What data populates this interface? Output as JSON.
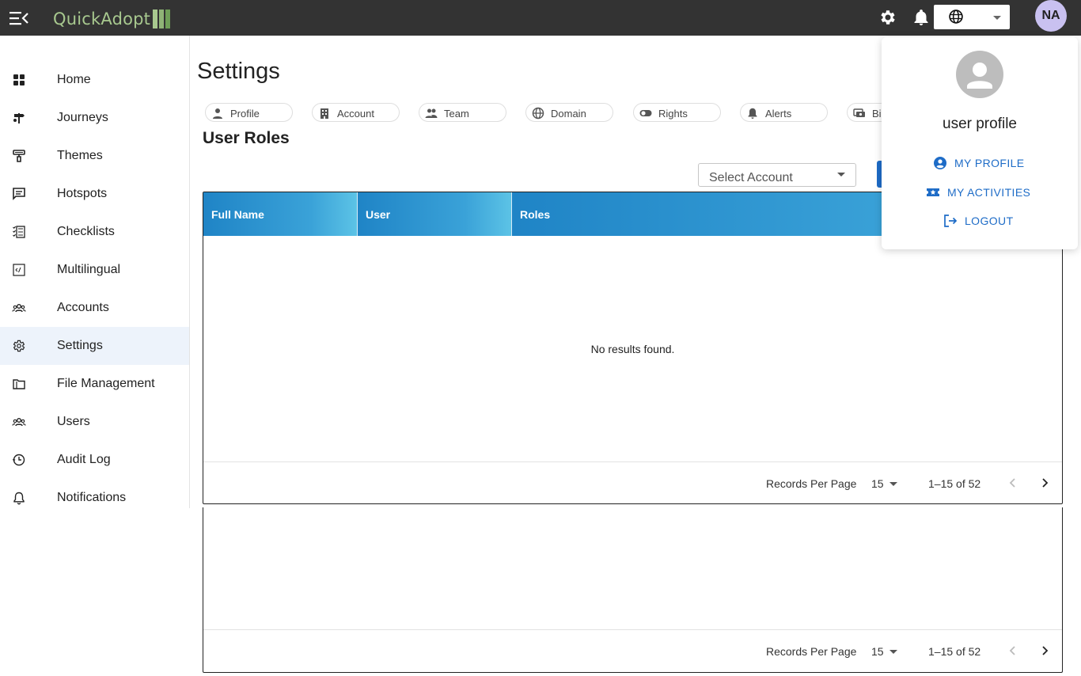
{
  "app": {
    "logo_text": "QuickAdopt",
    "avatar_initials": "NA"
  },
  "topbar": {
    "icons": [
      "menu-toggle-icon",
      "gear-icon",
      "bell-icon",
      "globe-icon",
      "chevron-down-icon"
    ]
  },
  "sidebar": {
    "items": [
      {
        "label": "Home",
        "icon": "grid-icon"
      },
      {
        "label": "Journeys",
        "icon": "signpost-icon"
      },
      {
        "label": "Themes",
        "icon": "paint-roller-icon"
      },
      {
        "label": "Hotspots",
        "icon": "comment-icon"
      },
      {
        "label": "Checklists",
        "icon": "checklist-icon"
      },
      {
        "label": "Multilingual",
        "icon": "code-icon"
      },
      {
        "label": "Accounts",
        "icon": "group-icon"
      },
      {
        "label": "Settings",
        "icon": "gear-icon",
        "active": true
      },
      {
        "label": "File Management",
        "icon": "folder-icon"
      },
      {
        "label": "Users",
        "icon": "users-icon"
      },
      {
        "label": "Audit Log",
        "icon": "history-icon"
      },
      {
        "label": "Notifications",
        "icon": "bell-icon"
      }
    ]
  },
  "main": {
    "title": "Settings",
    "tabs": [
      {
        "label": "Profile",
        "icon": "person-icon"
      },
      {
        "label": "Account",
        "icon": "building-icon"
      },
      {
        "label": "Team",
        "icon": "team-icon"
      },
      {
        "label": "Domain",
        "icon": "globe-icon"
      },
      {
        "label": "Rights",
        "icon": "toggle-icon"
      },
      {
        "label": "Alerts",
        "icon": "bell-icon"
      },
      {
        "label": "Bi",
        "icon": "billing-icon"
      }
    ],
    "section_title": "User Roles",
    "select_account": {
      "placeholder": "Select Account"
    },
    "table": {
      "columns": [
        "Full Name",
        "User",
        "Roles"
      ],
      "empty_message": "No results found."
    },
    "pager": {
      "records_label": "Records Per Page",
      "records_value": "15",
      "range": "1–15 of 52"
    }
  },
  "profile_popup": {
    "name": "user profile",
    "links": [
      {
        "label": "MY PROFILE",
        "icon": "account-circle-icon"
      },
      {
        "label": "MY ACTIVITIES",
        "icon": "ticket-icon"
      },
      {
        "label": "LOGOUT",
        "icon": "logout-icon"
      }
    ]
  },
  "colors": {
    "topbar": "#333333",
    "logo": "#a8c98f",
    "accent": "#1e6cc7",
    "header_gradient_start": "#1f84c6",
    "header_gradient_end": "#5cc3e6",
    "avatar_bg": "#c9c1f0",
    "active_nav": "#edf3fb"
  }
}
